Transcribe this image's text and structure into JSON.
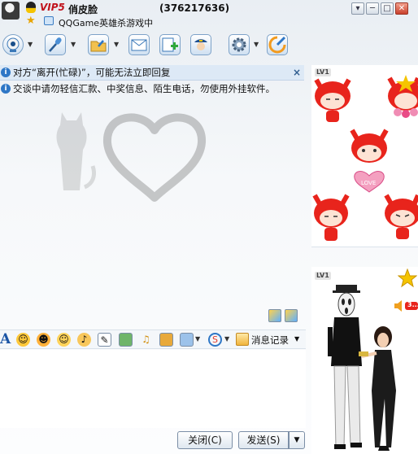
{
  "header": {
    "vip_label": "VIP5",
    "contact_name": "俏皮脸",
    "contact_qq": "(376217636)",
    "status_text": "QQGame英雄杀游戏中",
    "window_controls": [
      "▾",
      "─",
      "□",
      "✕"
    ]
  },
  "toolbar": {
    "items": [
      {
        "icon": "webcam-icon"
      },
      {
        "icon": "microphone-icon"
      },
      {
        "icon": "send-file-icon"
      },
      {
        "icon": "email-icon"
      },
      {
        "icon": "add-app-icon"
      },
      {
        "icon": "police-security-icon"
      },
      {
        "icon": "settings-icon"
      },
      {
        "icon": "qq-game-icon"
      }
    ]
  },
  "notices": {
    "away": "对方“离开(忙碌)”，可能无法立即回复",
    "security": "交谈中请勿轻信汇款、中奖信息、陌生电话，勿使用外挂软件。",
    "close_glyph": "×"
  },
  "input_toolbar": {
    "font_glyph": "A",
    "history_label": "消息记录"
  },
  "buttons": {
    "close": "关闭(C)",
    "send": "发送(S)",
    "send_dropdown": "▼"
  },
  "right_panel": {
    "top_level_badge": "LV1",
    "love_label": "LOVE",
    "bottom_level_badge": "LV1",
    "speech_text": "3..."
  },
  "colors": {
    "accent_blue": "#2f77c6",
    "vip_red": "#c1121c",
    "notice_bg": "#dde9f6",
    "fox_red": "#e8241c"
  }
}
